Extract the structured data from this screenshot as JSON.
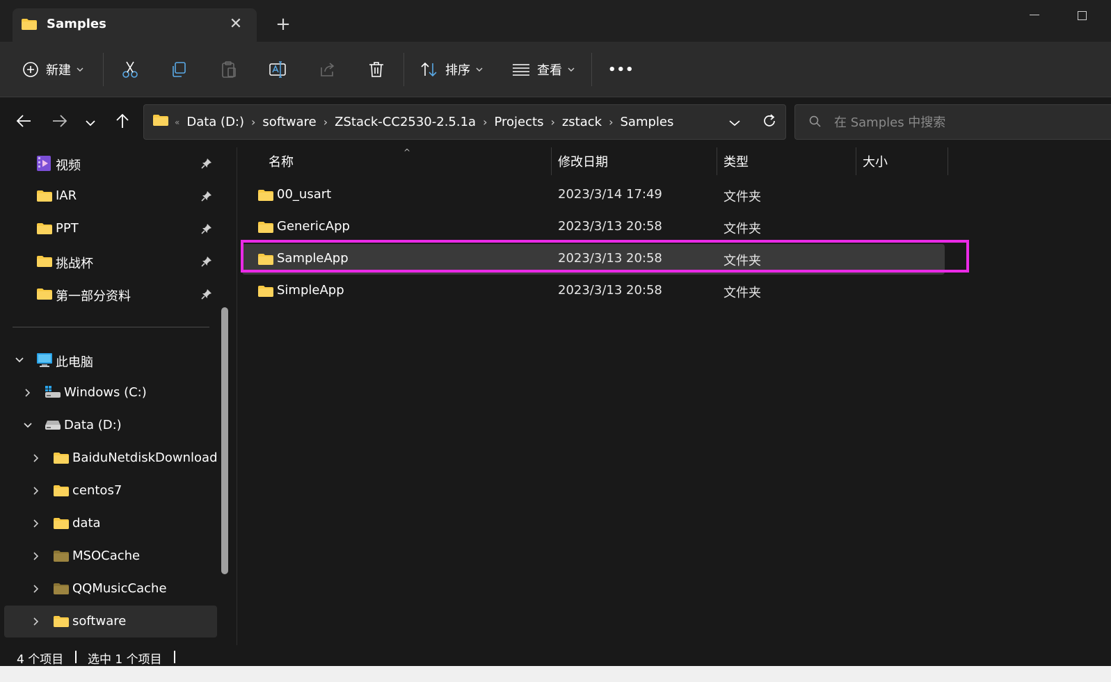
{
  "tab": {
    "title": "Samples",
    "close_label": "✕",
    "new_tab_label": "+"
  },
  "toolbar": {
    "new_label": "新建",
    "sort_label": "排序",
    "view_label": "查看",
    "more_label": "•••"
  },
  "address": {
    "breadcrumbs": [
      "Data (D:)",
      "software",
      "ZStack-CC2530-2.5.1a",
      "Projects",
      "zstack",
      "Samples"
    ]
  },
  "search": {
    "placeholder": "在 Samples 中搜索"
  },
  "sidebar": {
    "quick_access": [
      {
        "label": "视频",
        "icon": "video-folder-icon"
      },
      {
        "label": "IAR",
        "icon": "folder-icon"
      },
      {
        "label": "PPT",
        "icon": "folder-icon"
      },
      {
        "label": "挑战杯",
        "icon": "folder-icon"
      },
      {
        "label": "第一部分资料",
        "icon": "folder-icon"
      }
    ],
    "this_pc": "此电脑",
    "drives": [
      {
        "label": "Windows (C:)"
      },
      {
        "label": "Data (D:)"
      }
    ],
    "d_folders": [
      {
        "label": "BaiduNetdiskDownload"
      },
      {
        "label": "centos7"
      },
      {
        "label": "data"
      },
      {
        "label": "MSOCache"
      },
      {
        "label": "QQMusicCache"
      },
      {
        "label": "software"
      }
    ]
  },
  "columns": {
    "name": "名称",
    "date": "修改日期",
    "type": "类型",
    "size": "大小"
  },
  "files": [
    {
      "name": "00_usart",
      "date": "2023/3/14 17:49",
      "type": "文件夹"
    },
    {
      "name": "GenericApp",
      "date": "2023/3/13 20:58",
      "type": "文件夹"
    },
    {
      "name": "SampleApp",
      "date": "2023/3/13 20:58",
      "type": "文件夹"
    },
    {
      "name": "SimpleApp",
      "date": "2023/3/13 20:58",
      "type": "文件夹"
    }
  ],
  "status": {
    "count": "4 个项目",
    "selected": "选中 1 个项目"
  },
  "colors": {
    "folder": "#f8c943",
    "highlight": "#ea2ae6",
    "background": "#191919",
    "panel": "#2c2c2c"
  }
}
